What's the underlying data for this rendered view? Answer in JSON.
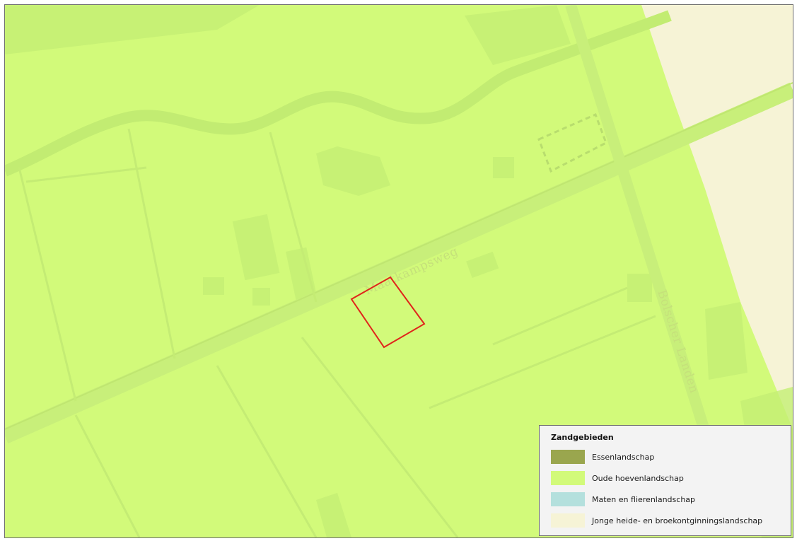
{
  "map": {
    "street_labels": {
      "maatkampsweg": "Maatkampsweg",
      "bolscher_landen": "Bolscher Landen"
    },
    "colors": {
      "oude_hoeven": "#d2fa7a",
      "jonge_heide": "#f6f3d6",
      "outline": "#e0241b"
    }
  },
  "legend": {
    "title": "Zandgebieden",
    "items": [
      {
        "label": "Essenlandschap",
        "color": "#9aa64e"
      },
      {
        "label": "Oude hoevenlandschap",
        "color": "#d2fa7a"
      },
      {
        "label": "Maten en flierenlandschap",
        "color": "#b4e0dd"
      },
      {
        "label": "Jonge heide- en broekontginningslandschap",
        "color": "#f6f3d6"
      }
    ]
  }
}
